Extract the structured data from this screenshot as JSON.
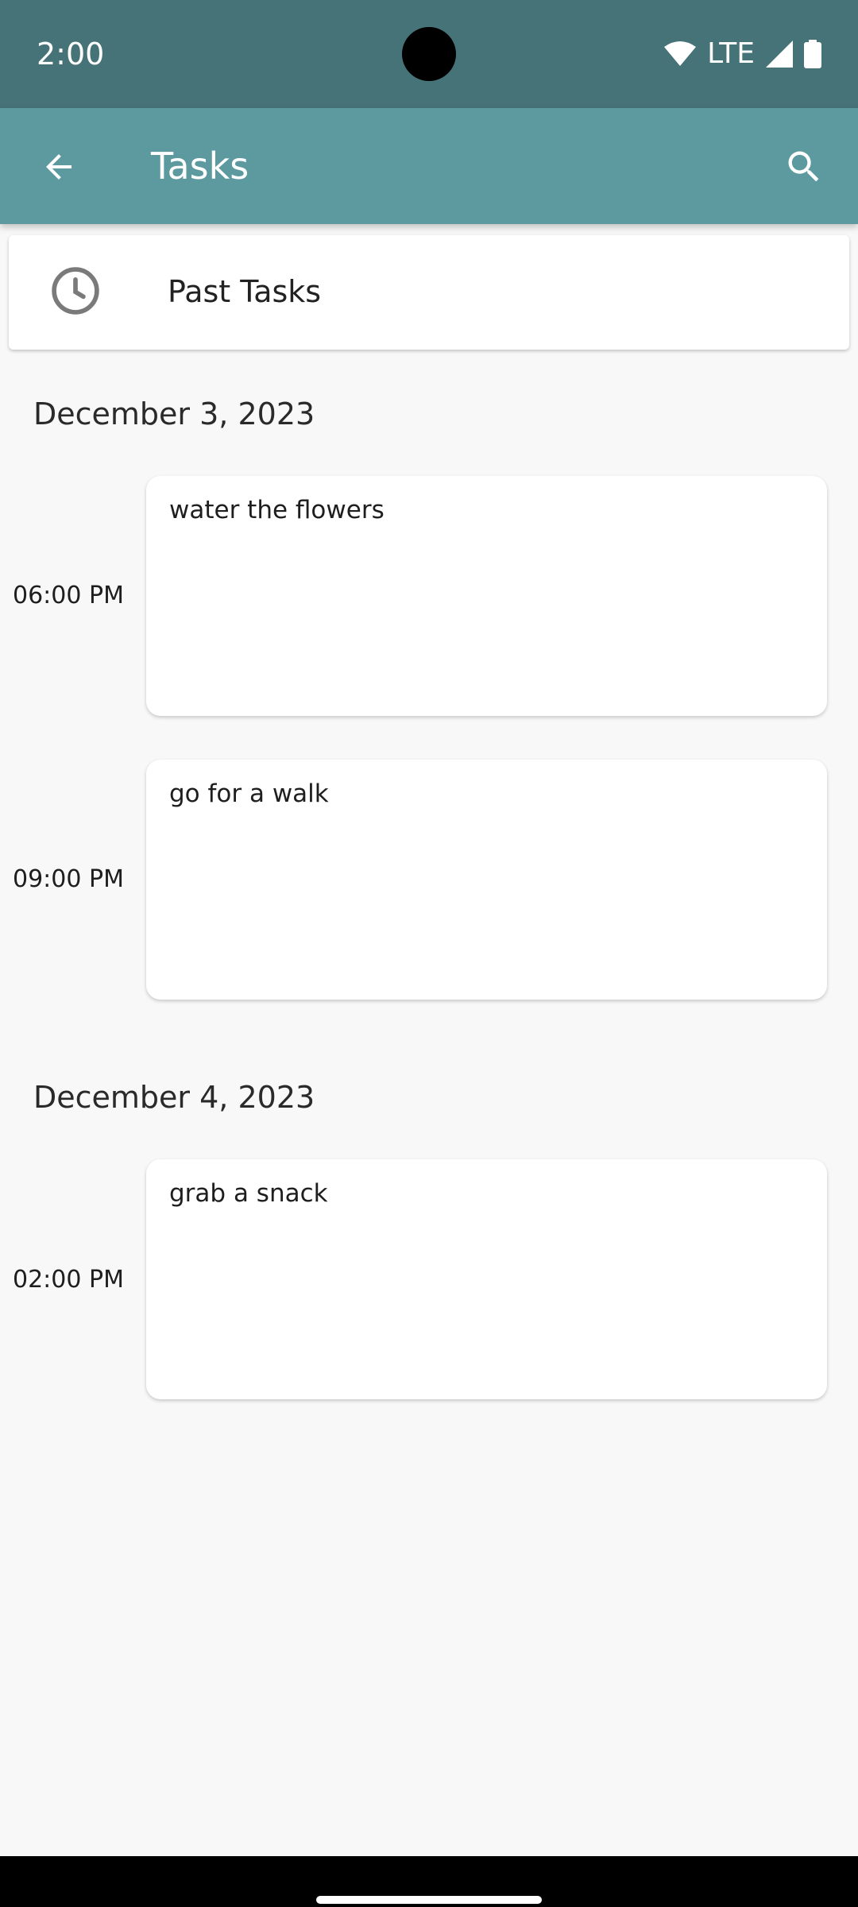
{
  "status_bar": {
    "time": "2:00",
    "network": "LTE",
    "icons": [
      "wifi-icon",
      "cell-signal-icon",
      "battery-icon"
    ]
  },
  "app_bar": {
    "title": "Tasks",
    "back_icon": "arrow-left-icon",
    "search_icon": "search-icon",
    "color": "#5c9aa0"
  },
  "past_tasks": {
    "label": "Past Tasks",
    "icon": "clock-icon"
  },
  "groups": [
    {
      "date": "December 3, 2023",
      "tasks": [
        {
          "time": "06:00 PM",
          "title": "water the flowers"
        },
        {
          "time": "09:00 PM",
          "title": "go for a walk"
        }
      ]
    },
    {
      "date": "December 4, 2023",
      "tasks": [
        {
          "time": "02:00 PM",
          "title": "grab a snack"
        }
      ]
    }
  ],
  "colors": {
    "status_bar": "#467377",
    "app_bar": "#5c9aa0",
    "background": "#f8f8f8",
    "card": "#ffffff"
  }
}
